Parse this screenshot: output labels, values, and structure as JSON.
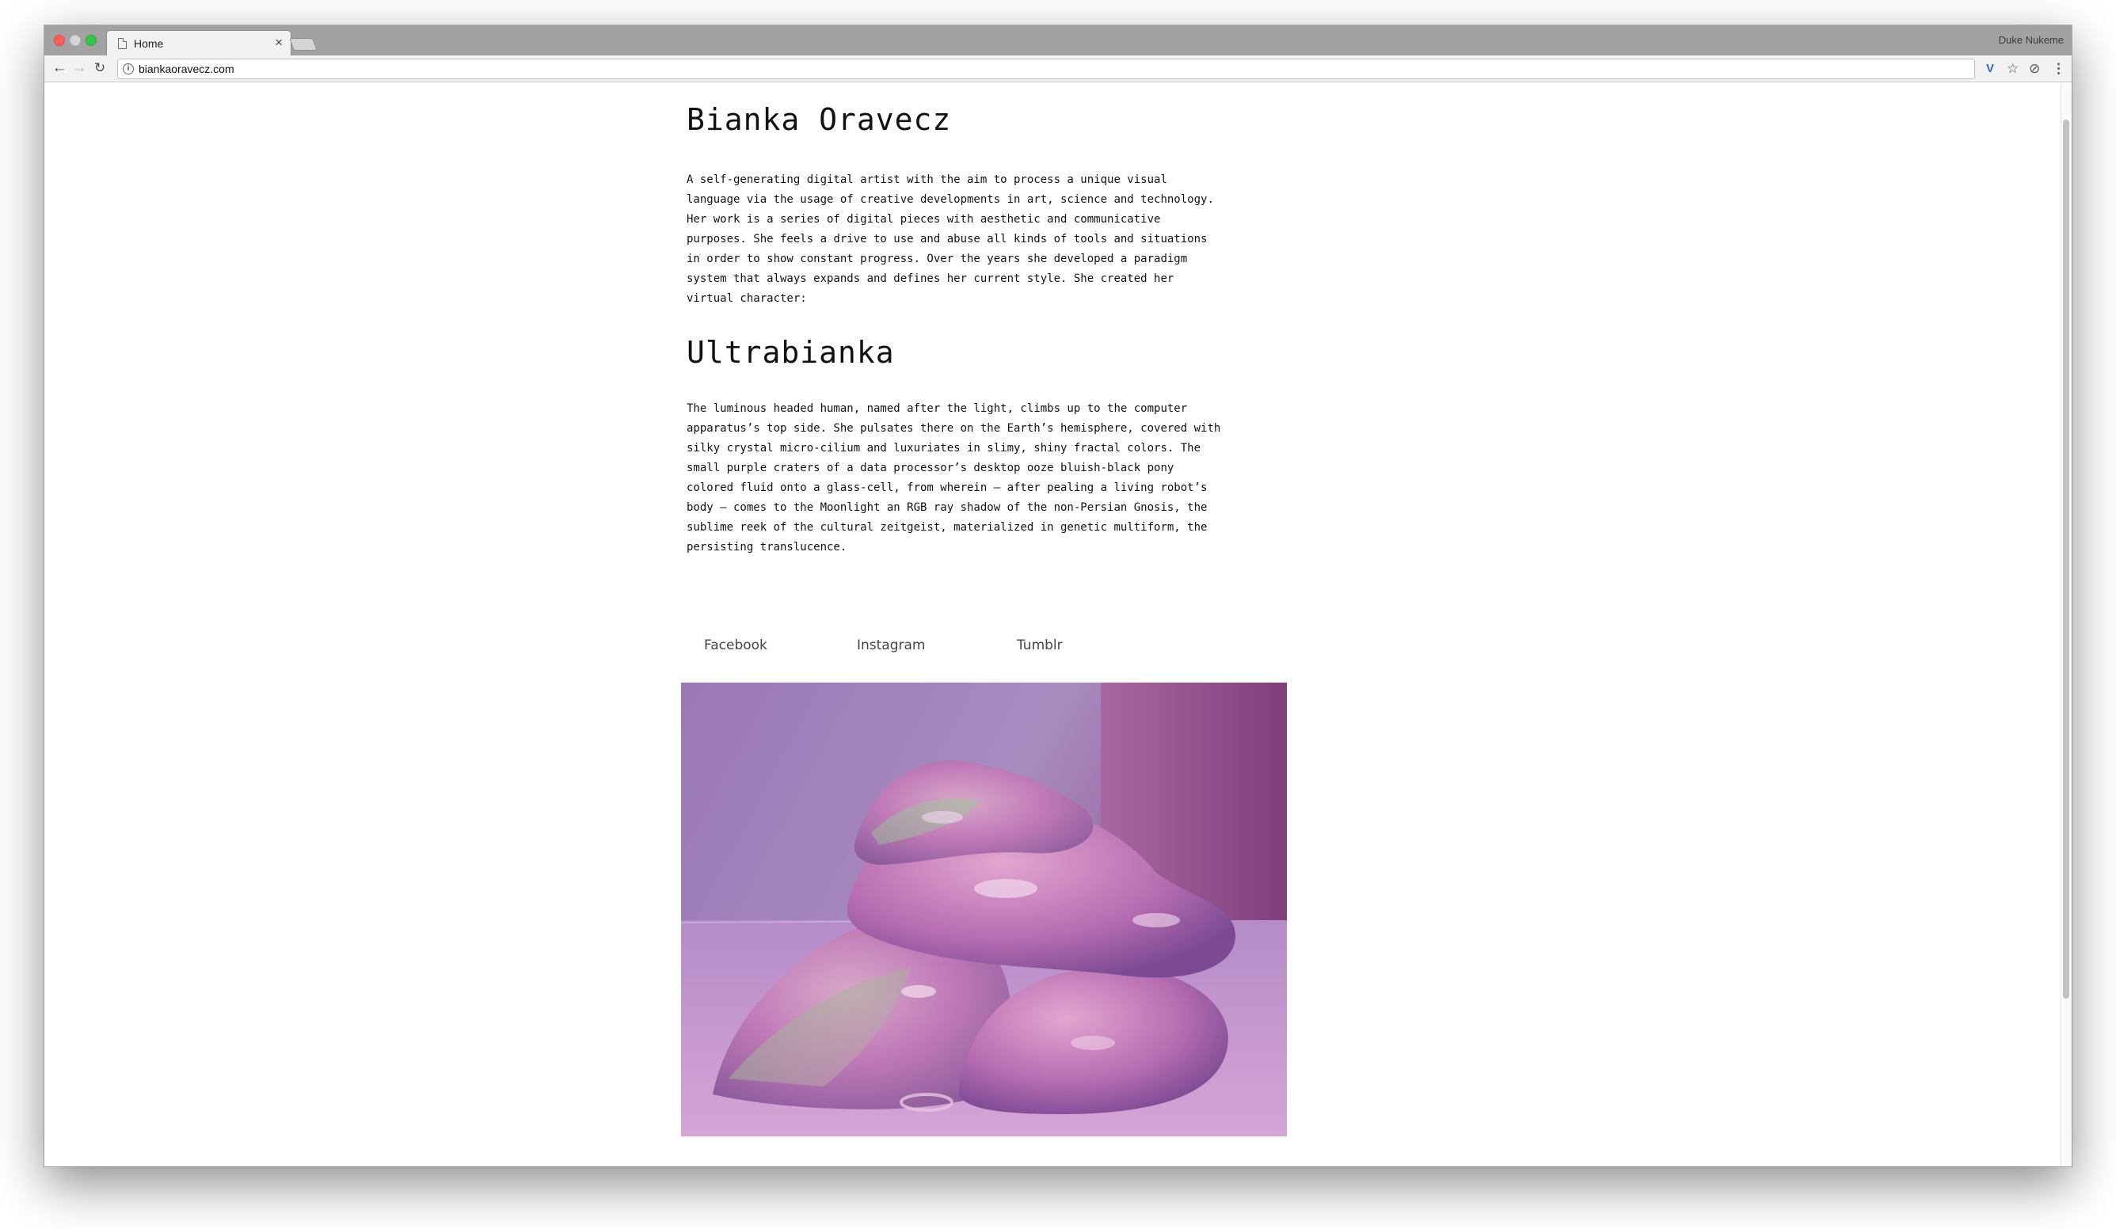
{
  "browser": {
    "tab_title": "Home",
    "tab_close": "×",
    "profile_name": "Duke Nukeme",
    "url": "biankaoravecz.com",
    "info_symbol": "i",
    "back_symbol": "←",
    "forward_symbol": "→",
    "reload_symbol": "↻",
    "extension_v": "V",
    "star_symbol": "☆",
    "extension_symbol": "⊘",
    "menu_symbol": "⋮"
  },
  "page": {
    "name": "Bianka Oravecz",
    "bio": "A self-generating digital artist with the aim to process a unique visual language via the usage of creative developments in art, science and technology. Her work is a series of digital pieces with aesthetic and communicative purposes. She feels a drive to use and abuse all kinds of tools and situations in order to show constant progress. Over the years she developed a paradigm system that always expands and defines her current style. She created her virtual character:",
    "character_name": "Ultrabianka",
    "story": "The luminous headed human, named after the light, climbs up to the computer apparatus’s top side. She pulsates there on the Earth’s hemisphere, covered with silky crystal micro-cilium and luxuriates in slimy, shiny fractal colors. The small purple craters of a data processor’s desktop ooze bluish-black pony colored fluid onto a glass-cell, from wherein – after pealing a living robot’s body – comes to the Moonlight an RGB ray shadow of the non-Persian Gnosis, the sublime reek of the cultural zeitgeist, materialized in genetic multiform, the persisting translucence.",
    "social_links": [
      "Facebook",
      "Instagram",
      "Tumblr"
    ]
  },
  "colors": {
    "close": "#fc605c",
    "zoom": "#34c749",
    "artwork_bg": "#a47db8"
  }
}
